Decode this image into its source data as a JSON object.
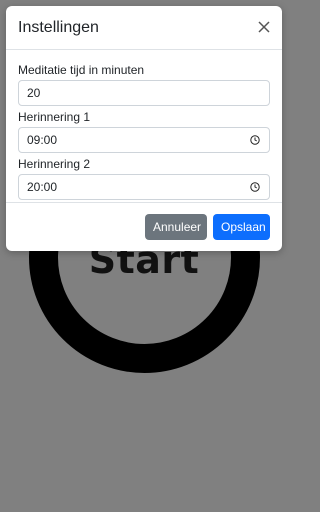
{
  "app": {
    "start_label": "Start"
  },
  "modal": {
    "title": "Instellingen",
    "fields": [
      {
        "label": "Meditatie tijd in minuten",
        "value": "20"
      },
      {
        "label": "Herinnering 1",
        "value": "09:00"
      },
      {
        "label": "Herinnering 2",
        "value": "20:00"
      }
    ],
    "cancel_label": "Annuleer",
    "save_label": "Opslaan"
  },
  "colors": {
    "primary": "#0d6efd",
    "secondary": "#6c757d",
    "backdrop": "#808080"
  },
  "icons": [
    "close-icon",
    "clock-icon"
  ]
}
